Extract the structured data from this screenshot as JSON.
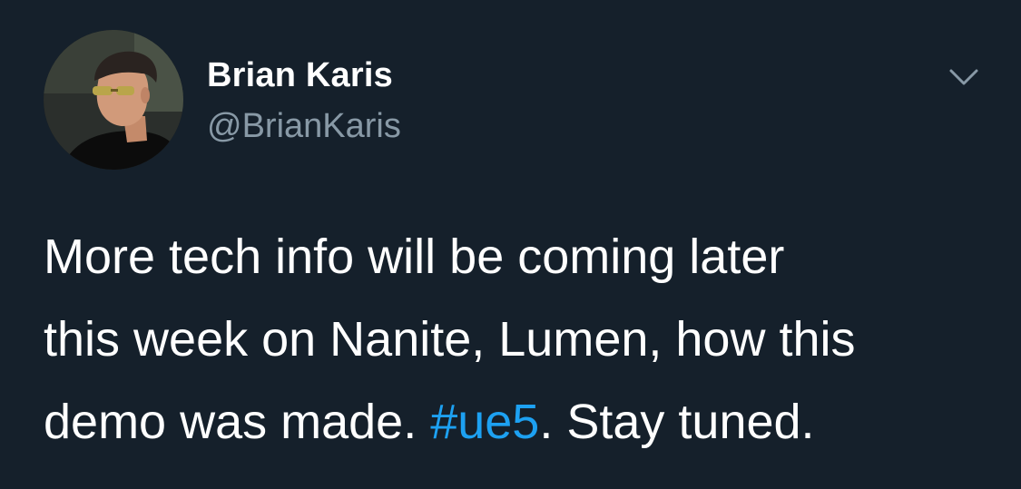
{
  "author": {
    "display_name": "Brian Karis",
    "handle": "@BrianKaris",
    "avatar_icon": "profile-photo"
  },
  "menu": {
    "icon": "chevron-down-icon"
  },
  "tweet": {
    "line1": "More tech info will be coming later",
    "line2": "this week on Nanite, Lumen, how this",
    "line3_before": "demo was made. ",
    "hashtag": "#ue5",
    "line3_after": ". Stay tuned."
  },
  "colors": {
    "background": "#15202b",
    "text": "#ffffff",
    "secondary_text": "#8899a6",
    "link": "#1da1f2"
  }
}
